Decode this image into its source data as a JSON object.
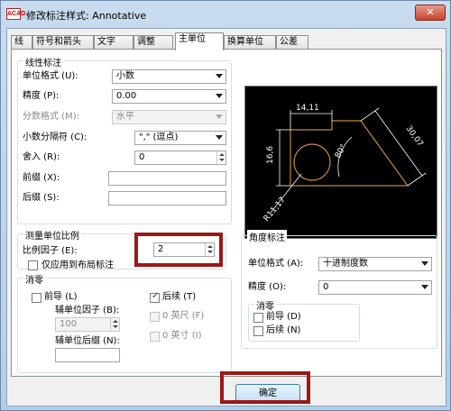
{
  "window": {
    "title": "修改标注样式: Annotative",
    "app_icon_text": "ACAD"
  },
  "tabs": [
    "线",
    "符号和箭头",
    "文字",
    "调整",
    "主单位",
    "换算单位",
    "公差"
  ],
  "linear": {
    "title": "线性标注",
    "unit_format_label": "单位格式 (U):",
    "unit_format_value": "小数",
    "precision_label": "精度 (P):",
    "precision_value": "0.00",
    "fraction_label": "分数格式 (M):",
    "fraction_value": "水平",
    "decimal_sep_label": "小数分隔符 (C):",
    "decimal_sep_value": "\",\" (逗点)",
    "round_label": "舍入 (R):",
    "round_value": "0",
    "prefix_label": "前缀 (X):",
    "prefix_value": "",
    "suffix_label": "后缀 (S):",
    "suffix_value": ""
  },
  "measure": {
    "title": "测量单位比例",
    "scale_label": "比例因子 (E):",
    "scale_value": "2",
    "layout_only_label": "仅应用到布局标注"
  },
  "zero": {
    "title": "消零",
    "leading_label": "前导 (L)",
    "trailing_label": "后续 (T)",
    "sub_factor_label": "辅单位因子 (B):",
    "sub_factor_value": "100",
    "sub_suffix_label": "辅单位后缀 (N):",
    "sub_suffix_value": "",
    "feet_label": "0 英尺 (F)",
    "inch_label": "0 英寸 (I)"
  },
  "angular": {
    "title": "角度标注",
    "unit_format_label": "单位格式 (A):",
    "unit_format_value": "十进制度数",
    "precision_label": "精度 (O):",
    "precision_value": "0",
    "zero_title": "消零",
    "leading_label": "前导 (D)",
    "trailing_label": "后续 (N)"
  },
  "preview": {
    "dim_top": "14,11",
    "dim_left": "16,6",
    "dim_right": "30,07",
    "dim_angle": "80°",
    "dim_radius": "R11,17"
  },
  "buttons": {
    "ok": "确定"
  },
  "colors": {
    "highlight": "#9a1818",
    "preview_bg": "#000000",
    "preview_shape": "#c08a3e"
  }
}
